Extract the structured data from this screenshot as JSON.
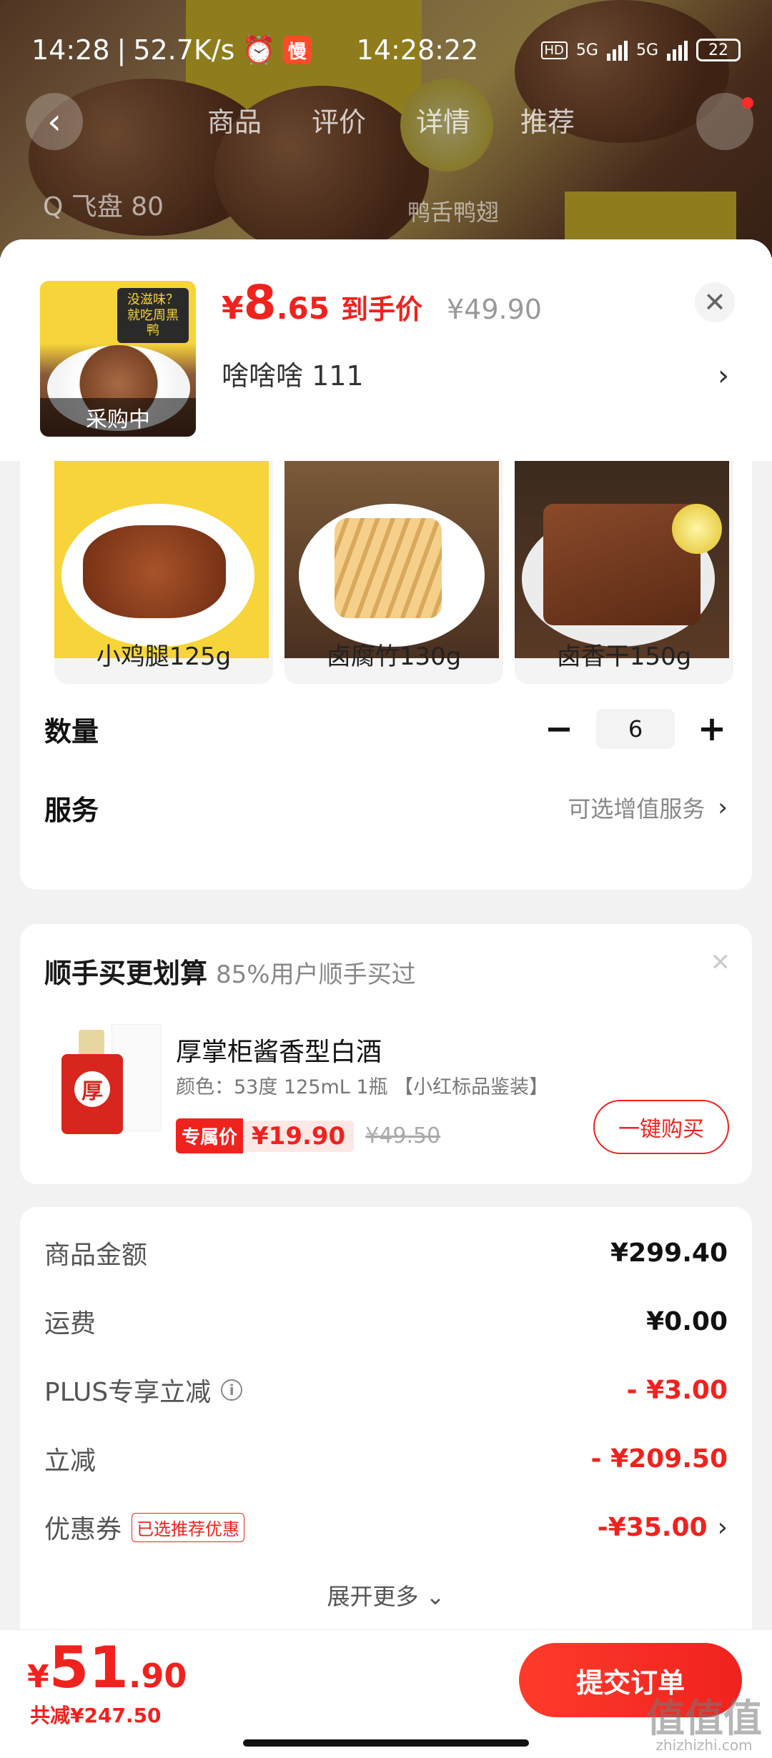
{
  "status_bar": {
    "time": "14:28",
    "speed": "52.7K/s",
    "slow_badge": "慢",
    "center_time": "14:28:22",
    "hd": "HD",
    "net1": "5G",
    "net2": "5G",
    "battery": "22"
  },
  "background_page": {
    "tabs": [
      "商品",
      "评价",
      "详情",
      "推荐"
    ],
    "search_placeholder": "Q 飞盘 80",
    "search_hint": "鸭舌鸭翅"
  },
  "header": {
    "thumbnail_tag": "采购中",
    "thumbnail_brand": "没滋味？就吃周黑鸭",
    "price_currency": "¥",
    "price_integer": "8",
    "price_decimal": ".65",
    "price_label": "到手价",
    "original_price": "¥49.90",
    "variant": "啥啥啥  111",
    "close_icon": "close-icon"
  },
  "options": [
    {
      "label": "小鸡腿125g"
    },
    {
      "label": "卤腐竹130g"
    },
    {
      "label": "卤香干150g"
    }
  ],
  "quantity": {
    "label": "数量",
    "value": "6",
    "minus": "−",
    "plus": "+"
  },
  "service": {
    "label": "服务",
    "hint": "可选增值服务"
  },
  "upsell": {
    "title": "顺手买更划算",
    "subtitle": "85%用户顺手买过",
    "product_name": "厚掌柜酱香型白酒",
    "spec": "颜色：53度 125mL 1瓶 【小红标品鉴装】",
    "exclusive_tag": "专属价",
    "exclusive_price": "¥19.90",
    "original_price": "¥49.50",
    "buy_button": "一键购买",
    "bottle_char": "厚"
  },
  "summary": {
    "rows": [
      {
        "label": "商品金额",
        "value": "¥299.40"
      },
      {
        "label": "运费",
        "value": "¥0.00"
      },
      {
        "label": "PLUS专享立减",
        "value": "- ¥3.00"
      },
      {
        "label": "立减",
        "value": "- ¥209.50"
      },
      {
        "label": "优惠券",
        "tag": "已选推荐优惠",
        "value": "-¥35.00"
      }
    ],
    "expand": "展开更多 ⌄"
  },
  "footer": {
    "currency": "¥",
    "total_integer": "51",
    "total_decimal": ".90",
    "saved": "共减¥247.50",
    "submit": "提交订单"
  },
  "watermark": {
    "main": "值值值",
    "sub": "zhizhizhi.com"
  },
  "colors": {
    "accent": "#f0221e",
    "background": "#f2f2f2"
  }
}
